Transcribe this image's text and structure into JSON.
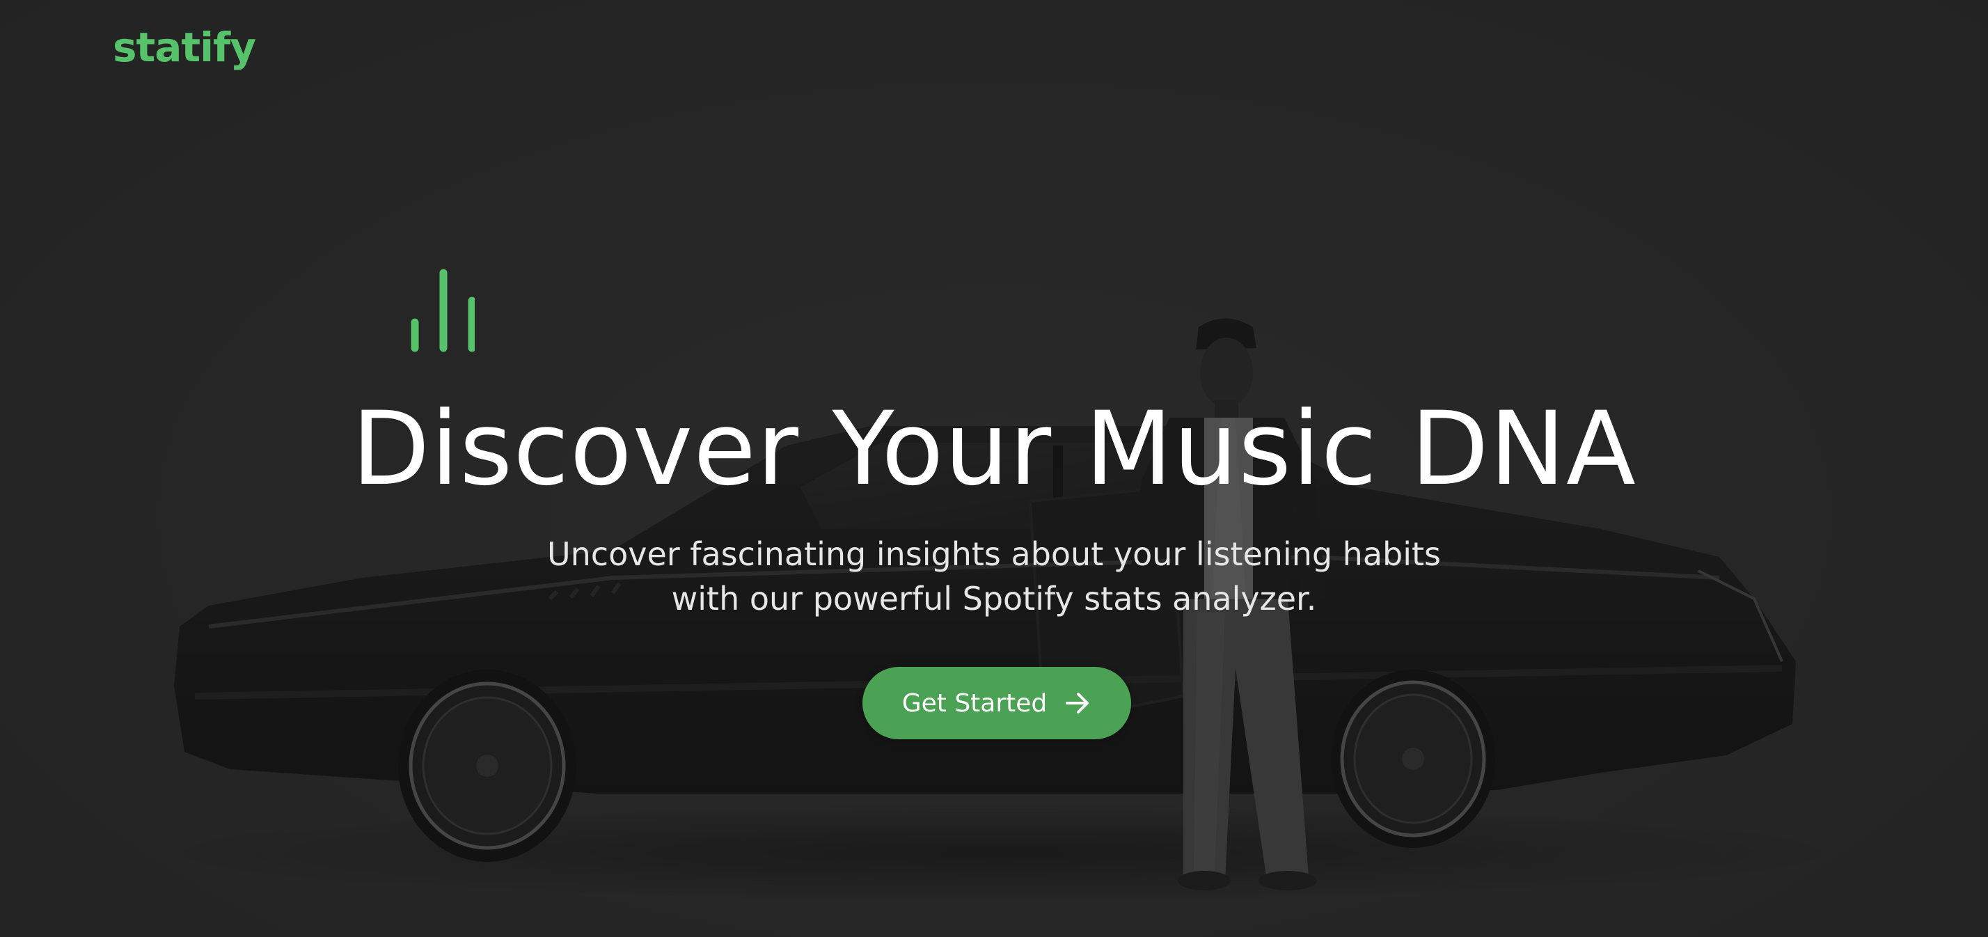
{
  "brand": {
    "name": "statify",
    "accent_color": "#56c36a",
    "button_color": "#4ba255"
  },
  "hero": {
    "icon": "equalizer-bars-icon",
    "title": "Discover Your Music DNA",
    "subtitle_lines": [
      "Uncover fascinating insights about your listening habits",
      "with our powerful Spotify stats analyzer."
    ],
    "cta": {
      "label": "Get Started",
      "icon": "arrow-right-icon"
    },
    "background": "black-and-white photo of a man standing beside a dark car"
  }
}
